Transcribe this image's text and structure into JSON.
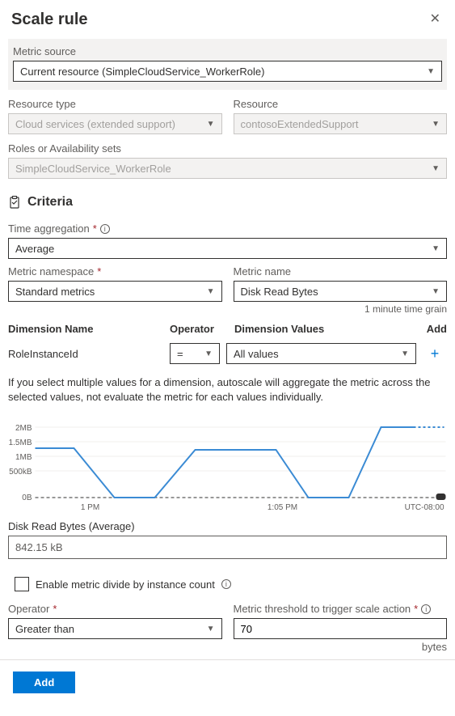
{
  "header": {
    "title": "Scale rule"
  },
  "metricSource": {
    "label": "Metric source",
    "value": "Current resource (SimpleCloudService_WorkerRole)"
  },
  "resourceType": {
    "label": "Resource type",
    "value": "Cloud services (extended support)"
  },
  "resource": {
    "label": "Resource",
    "value": "contosoExtendedSupport"
  },
  "rolesOrAvail": {
    "label": "Roles or Availability sets",
    "value": "SimpleCloudService_WorkerRole"
  },
  "criteria": {
    "heading": "Criteria"
  },
  "timeAgg": {
    "label": "Time aggregation",
    "value": "Average"
  },
  "metricNamespace": {
    "label": "Metric namespace",
    "value": "Standard metrics"
  },
  "metricName": {
    "label": "Metric name",
    "value": "Disk Read Bytes"
  },
  "timeGrain": "1 minute time grain",
  "dimTable": {
    "headers": {
      "name": "Dimension Name",
      "operator": "Operator",
      "values": "Dimension Values",
      "add": "Add"
    },
    "rows": [
      {
        "name": "RoleInstanceId",
        "operator": "=",
        "values": "All values"
      }
    ]
  },
  "helpText": "If you select multiple values for a dimension, autoscale will aggregate the metric across the selected values, not evaluate the metric for each values individually.",
  "chart_data": {
    "type": "line",
    "title": "",
    "xlabel": "",
    "ylabel": "",
    "ylim": [
      0,
      2200000
    ],
    "ytick_labels": [
      "0B",
      "500kB",
      "1MB",
      "1.5MB",
      "2MB"
    ],
    "x_tick_labels": [
      "1 PM",
      "1:05 PM"
    ],
    "tz": "UTC-08:00",
    "series": [
      {
        "name": "Disk Read Bytes",
        "x": [
          0,
          1,
          2,
          3,
          4,
          5,
          6,
          7,
          8,
          9
        ],
        "values": [
          1400000,
          1400000,
          0,
          0,
          1350000,
          1350000,
          1350000,
          0,
          0,
          2100000
        ]
      }
    ]
  },
  "avgMetric": {
    "label": "Disk Read Bytes (Average)",
    "value": "842.15 kB"
  },
  "enableDivide": {
    "label": "Enable metric divide by instance count",
    "checked": false
  },
  "operator": {
    "label": "Operator",
    "value": "Greater than"
  },
  "threshold": {
    "label": "Metric threshold to trigger scale action",
    "value": "70",
    "unit": "bytes"
  },
  "footer": {
    "add": "Add"
  }
}
